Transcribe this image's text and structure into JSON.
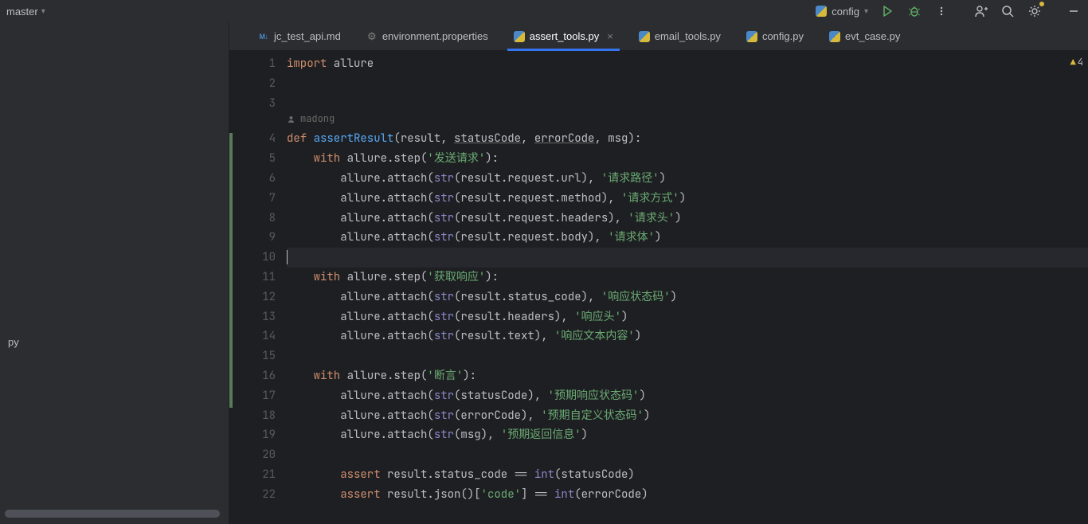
{
  "toolbar": {
    "branch": "master",
    "run_config": "config",
    "warnings_count": "4"
  },
  "sidebar": {
    "visible_file": "py"
  },
  "tabs": [
    {
      "label": "jc_test_api.md",
      "icon": "md",
      "active": false
    },
    {
      "label": "environment.properties",
      "icon": "gear",
      "active": false
    },
    {
      "label": "assert_tools.py",
      "icon": "py",
      "active": true
    },
    {
      "label": "email_tools.py",
      "icon": "py",
      "active": false
    },
    {
      "label": "config.py",
      "icon": "py",
      "active": false
    },
    {
      "label": "evt_case.py",
      "icon": "py",
      "active": false
    }
  ],
  "editor": {
    "author": "madong",
    "current_line_index": 9,
    "lines": [
      {
        "num": "1",
        "tokens": [
          [
            "k-import",
            "import"
          ],
          [
            "",
            " "
          ],
          [
            "",
            "allure"
          ]
        ]
      },
      {
        "num": "2",
        "tokens": []
      },
      {
        "num": "3",
        "tokens": []
      },
      {
        "num": "4",
        "tokens": [
          [
            "k-def",
            "def"
          ],
          [
            "",
            " "
          ],
          [
            "fn-name",
            "assertResult"
          ],
          [
            "",
            "(result, "
          ],
          [
            "param-u",
            "statusCode"
          ],
          [
            "",
            ", "
          ],
          [
            "param-u",
            "errorCode"
          ],
          [
            "",
            ", msg):"
          ]
        ]
      },
      {
        "num": "5",
        "tokens": [
          [
            "",
            "    "
          ],
          [
            "k-with",
            "with"
          ],
          [
            "",
            " allure.step("
          ],
          [
            "string",
            "'发送请求'"
          ],
          [
            "",
            "):"
          ]
        ]
      },
      {
        "num": "6",
        "tokens": [
          [
            "",
            "        allure.attach("
          ],
          [
            "builtin",
            "str"
          ],
          [
            "",
            "(result.request.url), "
          ],
          [
            "string",
            "'请求路径'"
          ],
          [
            "",
            ")"
          ]
        ]
      },
      {
        "num": "7",
        "tokens": [
          [
            "",
            "        allure.attach("
          ],
          [
            "builtin",
            "str"
          ],
          [
            "",
            "(result.request.method), "
          ],
          [
            "string",
            "'请求方式'"
          ],
          [
            "",
            ")"
          ]
        ]
      },
      {
        "num": "8",
        "tokens": [
          [
            "",
            "        allure.attach("
          ],
          [
            "builtin",
            "str"
          ],
          [
            "",
            "(result.request.headers), "
          ],
          [
            "string",
            "'请求头'"
          ],
          [
            "",
            ")"
          ]
        ]
      },
      {
        "num": "9",
        "tokens": [
          [
            "",
            "        allure.attach("
          ],
          [
            "builtin",
            "str"
          ],
          [
            "",
            "(result.request.body), "
          ],
          [
            "string",
            "'请求体'"
          ],
          [
            "",
            ")"
          ]
        ]
      },
      {
        "num": "10",
        "tokens": [],
        "current": true
      },
      {
        "num": "11",
        "tokens": [
          [
            "",
            "    "
          ],
          [
            "k-with",
            "with"
          ],
          [
            "",
            " allure.step("
          ],
          [
            "string",
            "'获取响应'"
          ],
          [
            "",
            "):"
          ]
        ]
      },
      {
        "num": "12",
        "tokens": [
          [
            "",
            "        allure.attach("
          ],
          [
            "builtin",
            "str"
          ],
          [
            "",
            "(result.status_code), "
          ],
          [
            "string",
            "'响应状态码'"
          ],
          [
            "",
            ")"
          ]
        ]
      },
      {
        "num": "13",
        "tokens": [
          [
            "",
            "        allure.attach("
          ],
          [
            "builtin",
            "str"
          ],
          [
            "",
            "(result.headers), "
          ],
          [
            "string",
            "'响应头'"
          ],
          [
            "",
            ")"
          ]
        ]
      },
      {
        "num": "14",
        "tokens": [
          [
            "",
            "        allure.attach("
          ],
          [
            "builtin",
            "str"
          ],
          [
            "",
            "(result.text), "
          ],
          [
            "string",
            "'响应文本内容'"
          ],
          [
            "",
            ")"
          ]
        ]
      },
      {
        "num": "15",
        "tokens": []
      },
      {
        "num": "16",
        "tokens": [
          [
            "",
            "    "
          ],
          [
            "k-with",
            "with"
          ],
          [
            "",
            " allure.step("
          ],
          [
            "string",
            "'断言'"
          ],
          [
            "",
            "):"
          ]
        ]
      },
      {
        "num": "17",
        "tokens": [
          [
            "",
            "        allure.attach("
          ],
          [
            "builtin",
            "str"
          ],
          [
            "",
            "(statusCode), "
          ],
          [
            "string",
            "'预期响应状态码'"
          ],
          [
            "",
            ")"
          ]
        ]
      },
      {
        "num": "18",
        "tokens": [
          [
            "",
            "        allure.attach("
          ],
          [
            "builtin",
            "str"
          ],
          [
            "",
            "(errorCode), "
          ],
          [
            "string",
            "'预期自定义状态码'"
          ],
          [
            "",
            ")"
          ]
        ]
      },
      {
        "num": "19",
        "tokens": [
          [
            "",
            "        allure.attach("
          ],
          [
            "builtin",
            "str"
          ],
          [
            "",
            "(msg), "
          ],
          [
            "string",
            "'预期返回信息'"
          ],
          [
            "",
            ")"
          ]
        ]
      },
      {
        "num": "20",
        "tokens": []
      },
      {
        "num": "21",
        "tokens": [
          [
            "",
            "        "
          ],
          [
            "k-assert",
            "assert"
          ],
          [
            "",
            " result.status_code == "
          ],
          [
            "builtin",
            "int"
          ],
          [
            "",
            "(statusCode)"
          ]
        ]
      },
      {
        "num": "22",
        "tokens": [
          [
            "",
            "        "
          ],
          [
            "k-assert",
            "assert"
          ],
          [
            "",
            " result.json()["
          ],
          [
            "string",
            "'code'"
          ],
          [
            "",
            "] == "
          ],
          [
            "builtin",
            "int"
          ],
          [
            "",
            "(errorCode)"
          ]
        ]
      }
    ]
  }
}
